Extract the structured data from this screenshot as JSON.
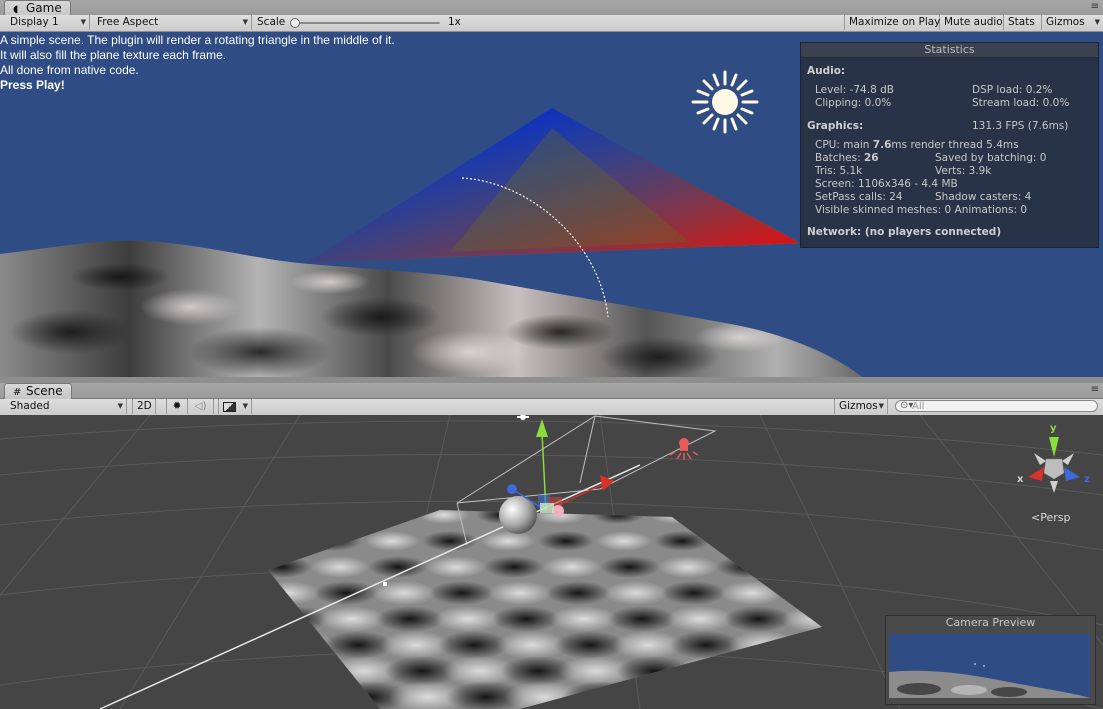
{
  "game_tab": {
    "label": "Game",
    "menu": "≡"
  },
  "game_toolbar": {
    "display": "Display 1",
    "aspect": "Free Aspect",
    "scale_label": "Scale",
    "scale_value": "1x",
    "maximize": "Maximize on Play",
    "mute": "Mute audio",
    "stats": "Stats",
    "gizmos": "Gizmos"
  },
  "game_text": {
    "line1": "A simple scene. The plugin will render a rotating triangle in the middle of it.",
    "line2": "It will also fill the plane texture each frame.",
    "line3": "All done from native code.",
    "line4": "Press Play!"
  },
  "stats": {
    "title": "Statistics",
    "audio_header": "Audio:",
    "level": "Level: -74.8 dB",
    "dsp": "DSP load: 0.2%",
    "clipping": "Clipping: 0.0%",
    "stream": "Stream load: 0.0%",
    "graphics_header": "Graphics:",
    "fps": "131.3 FPS (7.6ms)",
    "cpu_prefix": "CPU: main ",
    "cpu_main": "7.6",
    "cpu_suffix": "ms  render thread 5.4ms",
    "batches_prefix": "Batches: ",
    "batches": "26",
    "saved_batching": "Saved by batching: 0",
    "tris": "Tris: 5.1k",
    "verts": "Verts: 3.9k",
    "screen": "Screen: 1106x346 - 4.4 MB",
    "setpass": "SetPass calls: 24",
    "shadow": "Shadow casters: 4",
    "skinned": "Visible skinned meshes: 0  Animations: 0",
    "network": "Network: (no players connected)"
  },
  "scene_tab": {
    "label": "Scene",
    "menu": "≡"
  },
  "scene_toolbar": {
    "shading": "Shaded",
    "mode_2d": "2D",
    "gizmos": "Gizmos",
    "search_placeholder": "All"
  },
  "scene_view": {
    "persp_label": "Persp",
    "axis_x": "x",
    "axis_y": "y",
    "axis_z": "z",
    "camera_preview_title": "Camera Preview"
  },
  "colors": {
    "game_background": "#2f4d84",
    "scene_background": "#454545",
    "triangle_top": "#0000ff",
    "triangle_left": "#00ff00",
    "triangle_right": "#ff0000"
  },
  "icons": [
    "game-icon",
    "scene-icon",
    "sun-icon",
    "audio-icon",
    "image-icon",
    "search-icon",
    "move-gizmo-icon",
    "light-icon",
    "camera-icon",
    "scene-orientation-gizmo"
  ]
}
